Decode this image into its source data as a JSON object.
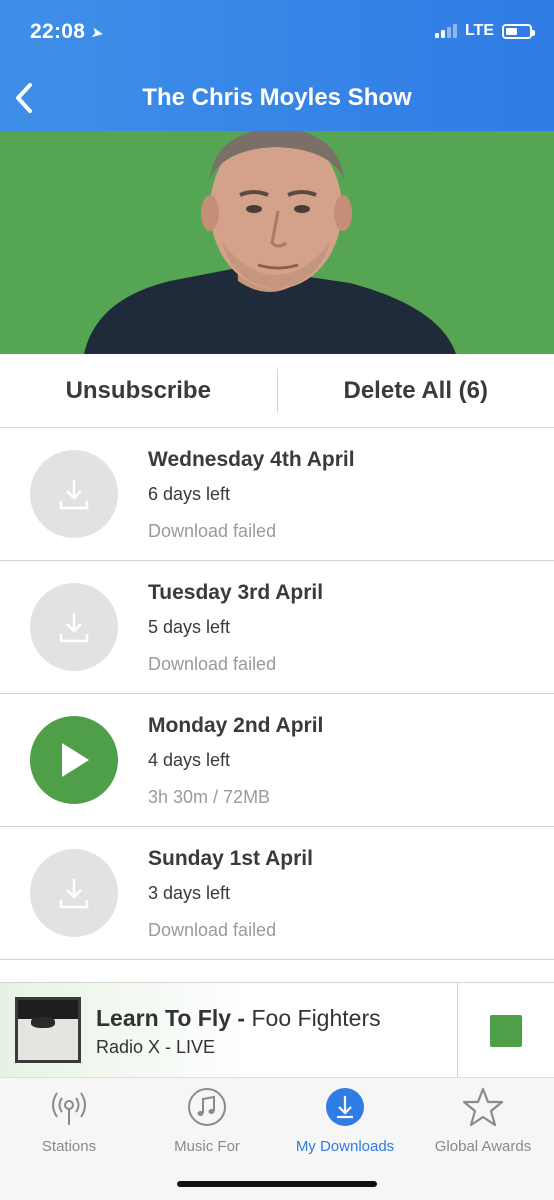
{
  "status_bar": {
    "time": "22:08",
    "network": "LTE",
    "battery_level": 0.5
  },
  "header": {
    "title": "The Chris Moyles Show",
    "back_icon": "chevron-left-icon"
  },
  "colors": {
    "brand_blue": "#2f7ce5",
    "accent_green": "#4e9f48",
    "hero_green": "#55a552"
  },
  "actions": {
    "unsubscribe": "Unsubscribe",
    "delete_all": "Delete All (6)"
  },
  "episodes": [
    {
      "title": "Wednesday 4th April",
      "days_left": "6 days left",
      "status": "Download failed",
      "icon": "download-icon"
    },
    {
      "title": "Tuesday 3rd April",
      "days_left": "5 days left",
      "status": "Download failed",
      "icon": "download-icon"
    },
    {
      "title": "Monday 2nd April",
      "days_left": "4 days left",
      "status": "3h 30m / 72MB",
      "icon": "play-icon"
    },
    {
      "title": "Sunday 1st April",
      "days_left": "3 days left",
      "status": "Download failed",
      "icon": "download-icon"
    }
  ],
  "now_playing": {
    "song": "Learn To Fly",
    "separator": " - ",
    "artist": "Foo Fighters",
    "station": "Radio X - LIVE",
    "control_icon": "stop-icon"
  },
  "tabs": [
    {
      "label": "Stations",
      "icon": "radio-tower-icon",
      "active": false
    },
    {
      "label": "Music For",
      "icon": "music-note-icon",
      "active": false
    },
    {
      "label": "My Downloads",
      "icon": "download-icon",
      "active": true
    },
    {
      "label": "Global Awards",
      "icon": "star-icon",
      "active": false
    }
  ]
}
